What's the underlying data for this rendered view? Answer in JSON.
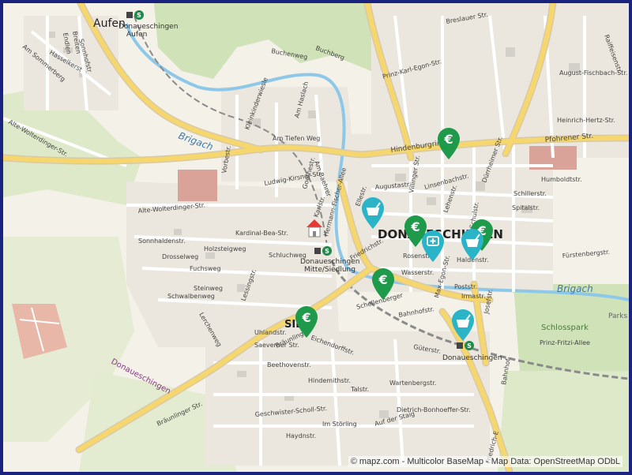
{
  "attribution": "© mapz.com - Multicolor BaseMap - Map Data: OpenStreetMap ODbL",
  "places": {
    "city": "DONAUESCHINGEN",
    "village": "Aufen",
    "district_sie": "SIE",
    "park": "Schlosspark",
    "parks_label": "Parks",
    "region": "Donaueschingen"
  },
  "rivers": {
    "brigach_west": "Brigach",
    "brigach_east": "Brigach"
  },
  "stations": [
    {
      "id": "aufen",
      "label1": "Donaueschingen",
      "label2": "Aufen"
    },
    {
      "id": "mitte",
      "label1": "Donaueschingen",
      "label2": "Mitte/Siedlung"
    },
    {
      "id": "main",
      "label1": "Donaueschingen",
      "label2": ""
    }
  ],
  "streets": {
    "buchenweg": "Buchenweg",
    "buchberg": "Buchberg",
    "am_sommerberg": "Am Sommerberg",
    "endlen": "Endlen",
    "breiten": "Breiten",
    "hasselkerst": "Hasselkerst",
    "sonnhofstr": "Sonnhofstr",
    "alte_wolterdinger": "Alte-Wolterdinger-Str.",
    "alte_wolterdinger2": "Alte-Wolterdinger-Str.",
    "hindenburgring": "Hindenburgring",
    "pfohrener": "Pfohrener Str.",
    "breslauer": "Breslauer Str.",
    "prinz_karl": "Prinz-Karl-Egon-Str.",
    "am_tiefen_weg": "Am Tiefen Weg",
    "vorbestr": "Vorbestr.",
    "ludwig_kirsner": "Ludwig-Kirsner-Str.",
    "hermann_fischer": "Hermann-Fischer-Allee",
    "karlstr": "Karlstr.",
    "augustastr": "Augustastr.",
    "humboldtstr": "Humboldtstr.",
    "schillerstr": "Schillerstr.",
    "spitalstr": "Spitalstr.",
    "fuerstenbergstr": "Fürstenbergstr.",
    "haldenstr": "Haldenstr.",
    "wasserstr": "Wasserstr.",
    "poststr": "Poststr.",
    "irmastr": "Irmastr.",
    "josefstr": "Josefstr.",
    "bahnhofstr": "Bahnhofstr.",
    "gueterstr": "Güterstr.",
    "schellenberger": "Schellenberger",
    "braeunlinger": "Bräunlinger",
    "braeunlinger_str": "Bräunlinger Str.",
    "eichendorffstr": "Eichendorffstr.",
    "beethovenstr": "Beethovenstr.",
    "hindemithstr": "Hindemithstr.",
    "talstr": "Talstr.",
    "wartenbergstr": "Wartenbergstr.",
    "dietrich": "Dietrich-Bonhoeffer-Str.",
    "geschwister": "Geschwister-Scholl-Str.",
    "haydnstr": "Haydnstr.",
    "im_stoerling": "Im Störling",
    "auf_der_staig": "Auf der Staig",
    "sonnhaldenstr": "Sonnhaldenstr.",
    "drosselweg": "Drosselweg",
    "holzsteigweg": "Holzsteigweg",
    "fuchsweg": "Fuchsweg",
    "steinweg": "Steinweg",
    "schwalbenweg": "Schwalbenweg",
    "lerchenweg": "Lerchenweg",
    "uhlandstr": "Uhlandstr.",
    "saeverner": "Saeverner Str.",
    "lessingstr": "Lessingstr.",
    "schluchweg": "Schluchweg",
    "friedrichstr": "Friedrichstr.",
    "ellestr": "Ellestr.",
    "rosenstr": "Rosenstr.",
    "lehenstr": "Lehenstr.",
    "schulstr": "Schulstr.",
    "duerrheimer": "Dürrheimer Str.",
    "august_fischbach": "August-Fischbach-Str.",
    "heinrich_hertz": "Heinrich-Hertz-Str.",
    "prinz_fritzi": "Prinz-Fritzi-Allee",
    "friedrich_e": "Friedrich-E",
    "bahnhof_e": "Bahnhof-",
    "max_egon": "Max-Egon-Str.",
    "villinger": "Villinger Str.",
    "karlstr2": "Karlstr.",
    "linsenbachstr": "Linsenbachstr.",
    "raiffeisen": "Raiffeisenstr.",
    "kardinal": "Kardinal-Bea-Str.",
    "goethestr": "Goethestr.",
    "am_baehrer": "Am Baehrer",
    "kleinkinderwiesle": "Kleinkinderwiesle",
    "am_haslach": "Am Haslach"
  },
  "pois": [
    {
      "type": "atm",
      "icon": "euro-icon"
    },
    {
      "type": "atm",
      "icon": "euro-icon"
    },
    {
      "type": "atm",
      "icon": "euro-icon"
    },
    {
      "type": "atm",
      "icon": "euro-icon"
    },
    {
      "type": "atm",
      "icon": "euro-icon"
    },
    {
      "type": "pharmacy",
      "icon": "mortar-icon"
    },
    {
      "type": "pharmacy",
      "icon": "mortar-icon"
    },
    {
      "type": "hospital",
      "icon": "first-aid-icon"
    },
    {
      "type": "pharmacy",
      "icon": "mortar-icon"
    },
    {
      "type": "home",
      "icon": "home-icon"
    }
  ],
  "colors": {
    "background": "#f4f1e8",
    "forest": "#cfe2b8",
    "green": "#dde9c8",
    "water": "#8ec8e8",
    "major_road": "#f5d76e",
    "road_edge": "#d9c9a8",
    "minor_road": "#ffffff",
    "building": "#d3d0ca",
    "atm": "#1f9a4a",
    "pharmacy": "#2bb3c8",
    "home_roof": "#e53935",
    "frame": "#1a237e"
  }
}
